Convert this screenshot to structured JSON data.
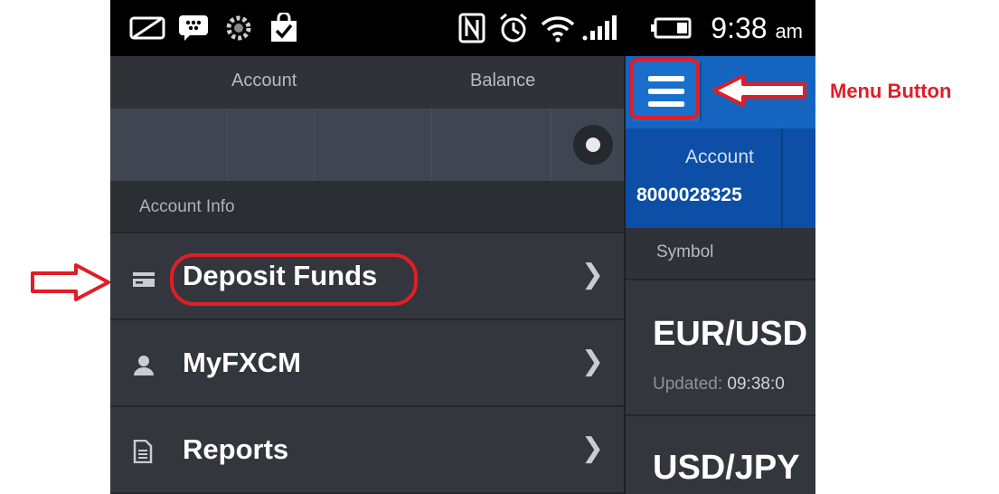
{
  "status_bar": {
    "time": "9:38",
    "ampm": "am",
    "icons": [
      "no-sim-icon",
      "bbm-icon",
      "settings-icon",
      "check-bag-icon",
      "nfc-icon",
      "alarm-icon",
      "wifi-icon",
      "signal-icon",
      "battery-icon"
    ]
  },
  "drawer": {
    "header": {
      "account": "Account",
      "balance": "Balance"
    },
    "section_label": "Account Info",
    "items": [
      {
        "label": "Deposit Funds",
        "icon": "card-icon"
      },
      {
        "label": "MyFXCM",
        "icon": "person-icon"
      },
      {
        "label": "Reports",
        "icon": "document-icon"
      }
    ]
  },
  "main": {
    "account_label": "Account",
    "account_number": "8000028325",
    "symbol_header": "Symbol",
    "rows": [
      {
        "symbol": "EUR/USD",
        "updated_label": "Updated:",
        "updated_time": "09:38:0"
      },
      {
        "symbol": "USD/JPY"
      }
    ]
  },
  "annotations": {
    "menu_button_label": "Menu Button",
    "color": "#e11d26"
  },
  "colors": {
    "accent_blue": "#1565c0",
    "dark_blue": "#0d4ea6",
    "drawer_bg": "#33373d"
  }
}
